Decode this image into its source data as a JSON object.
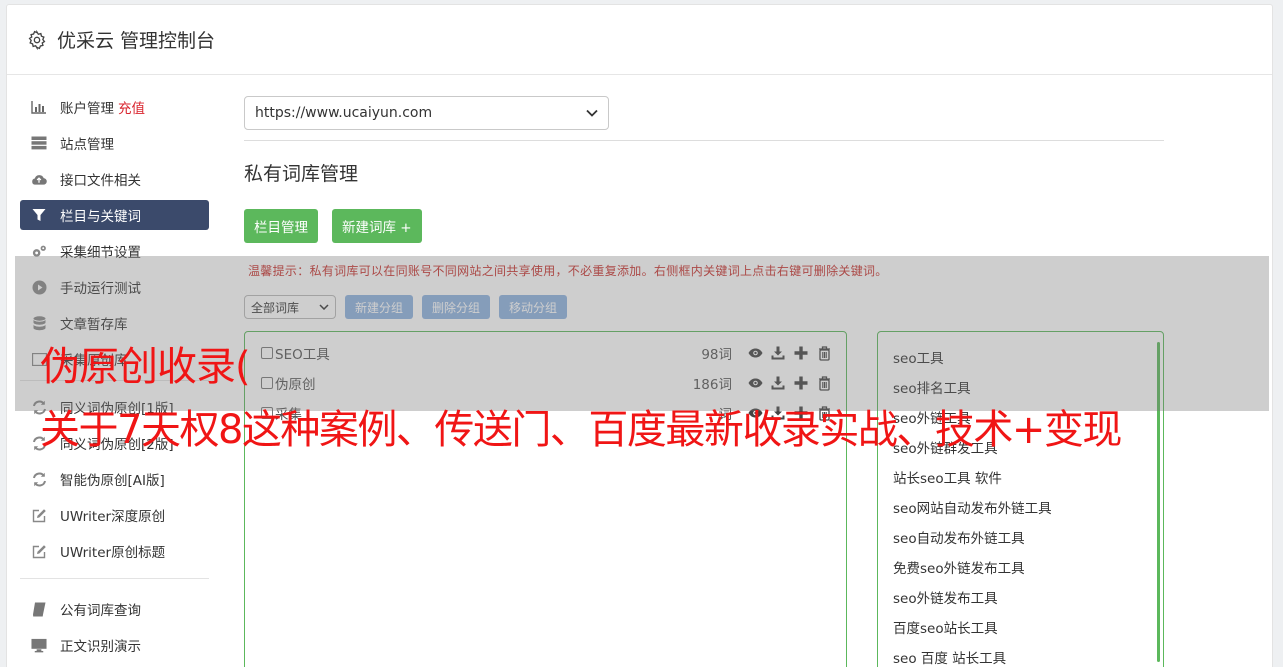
{
  "header": {
    "title": "优采云 管理控制台",
    "icon": "gear-icon"
  },
  "sidebar": {
    "items": [
      {
        "label": "账户管理",
        "badge": "充值",
        "icon": "bar-chart-icon"
      },
      {
        "label": "站点管理",
        "icon": "server-icon"
      },
      {
        "label": "接口文件相关",
        "icon": "cloud-upload-icon"
      },
      {
        "label": "栏目与关键词",
        "icon": "filter-icon",
        "active": true
      },
      {
        "label": "采集细节设置",
        "icon": "cogs-icon"
      },
      {
        "label": "手动运行测试",
        "icon": "play-circle-icon"
      },
      {
        "label": "文章暂存库",
        "icon": "database-icon"
      },
      {
        "label": "采集原创库",
        "icon": "folder-icon"
      },
      {
        "label": "同义词伪原创[1版]",
        "icon": "refresh-icon"
      },
      {
        "label": "同义词伪原创[2版]",
        "icon": "refresh-icon"
      },
      {
        "label": "智能伪原创[AI版]",
        "icon": "refresh-icon"
      },
      {
        "label": "UWriter深度原创",
        "icon": "edit-icon"
      },
      {
        "label": "UWriter原创标题",
        "icon": "edit-icon"
      }
    ],
    "items2": [
      {
        "label": "公有词库查询",
        "icon": "book-icon"
      },
      {
        "label": "正文识别演示",
        "icon": "desktop-icon"
      }
    ]
  },
  "main": {
    "site_select": "https://www.ucaiyun.com",
    "section_title": "私有词库管理",
    "btn_column_manage": "栏目管理",
    "btn_new_library": "新建词库 +",
    "tip": "温馨提示：私有词库可以在同账号不同网站之间共享使用，不必重复添加。右侧框内关键词上点击右键可删除关键词。",
    "group_select": "全部词库",
    "btn_new_group": "新建分组",
    "btn_delete_group": "删除分组",
    "btn_move_group": "移动分组",
    "libraries": [
      {
        "name": "SEO工具",
        "count": "98词"
      },
      {
        "name": "伪原创",
        "count": "186词"
      },
      {
        "name": "采集",
        "count": "词"
      }
    ],
    "keywords": [
      "seo工具",
      "seo排名工具",
      "seo外链工具",
      "seo外链群发工具",
      "站长seo工具 软件",
      "seo网站自动发布外链工具",
      "seo自动发布外链工具",
      "免费seo外链发布工具",
      "seo外链发布工具",
      "百度seo站长工具",
      "seo 百度 站长工具"
    ]
  },
  "overlay": {
    "line1": "伪原创收录(",
    "line2": "关于7天权8这种案例、传送门、百度最新收录实战、技术+变现"
  },
  "colors": {
    "accent_green": "#5cb85c",
    "active_nav": "#3b4a6b",
    "overlay_text": "#f01515",
    "blue_btn": "#8eb2e0"
  }
}
